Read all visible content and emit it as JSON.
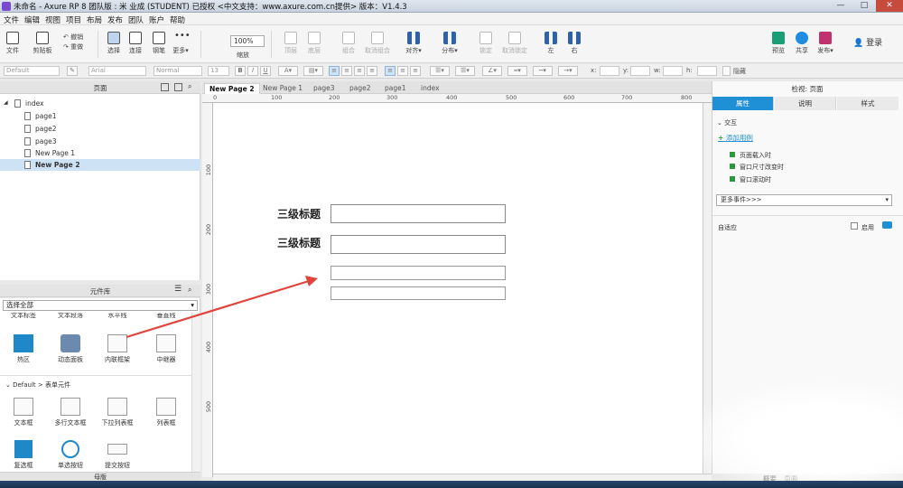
{
  "window": {
    "title": "未命名 - Axure RP 8 团队版 : 米 业成 (STUDENT) 已授权    <中文支持：www.axure.com.cn提供> 版本：V1.4.3",
    "min": "—",
    "max": "□",
    "close": "✕"
  },
  "menu": [
    "文件",
    "编辑",
    "视图",
    "项目",
    "布局",
    "发布",
    "团队",
    "账户",
    "帮助"
  ],
  "toolbar": {
    "file": "文件",
    "clipboard": "剪贴板",
    "undo": "撤销",
    "redo": "重做",
    "select": "选择",
    "connect": "连接",
    "pen": "钢笔",
    "more": "更多▾",
    "zoom_value": "100%",
    "zoom_label": "缩放",
    "top": "顶层",
    "bottom": "底层",
    "group": "组合",
    "ungroup": "取消组合",
    "align": "对齐▾",
    "distribute": "分布▾",
    "lock": "锁定",
    "unlock": "取消锁定",
    "left": "左",
    "right": "右",
    "preview": "预览",
    "share": "共享",
    "publish": "发布▾",
    "login": "登录",
    "user_icon": "user-icon"
  },
  "stylebar": {
    "style": "Default",
    "font": "Arial",
    "weight": "Normal",
    "size": "13",
    "x_label": "x:",
    "y_label": "y:",
    "w_label": "w:",
    "h_label": "h:",
    "hide": "隐藏"
  },
  "pages_panel": {
    "title": "页面",
    "items": [
      {
        "label": "index",
        "root": true
      },
      {
        "label": "page1"
      },
      {
        "label": "page2"
      },
      {
        "label": "page3"
      },
      {
        "label": "New Page 1"
      },
      {
        "label": "New Page 2",
        "selected": true
      }
    ]
  },
  "library": {
    "title": "元件库",
    "select": "选择全部",
    "row_cut": [
      "文本标签",
      "文本段落",
      "水平线",
      "垂直线"
    ],
    "row1": [
      "热区",
      "动态面板",
      "内联框架",
      "中继器"
    ],
    "section": "Default > 表单元件",
    "row2": [
      "文本框",
      "多行文本框",
      "下拉列表框",
      "列表框"
    ],
    "row3": [
      "复选框",
      "单选按钮",
      "提交按钮"
    ]
  },
  "bottom_panel": "母版",
  "tabs": [
    "New Page 2",
    "New Page 1",
    "page3",
    "page2",
    "page1",
    "index"
  ],
  "ruler_h": [
    "0",
    "100",
    "200",
    "300",
    "400",
    "500",
    "600",
    "700",
    "800"
  ],
  "ruler_v": [
    "100",
    "200",
    "300",
    "400",
    "500"
  ],
  "canvas": {
    "label1": "三级标题",
    "label2": "三级标题"
  },
  "inspector": {
    "title": "检视: 页面",
    "tabs": [
      "属性",
      "说明",
      "样式"
    ],
    "interaction": "交互",
    "add_case": "添加用例",
    "events": [
      "页面载入时",
      "窗口尺寸改变时",
      "窗口滚动时"
    ],
    "more_events": "更多事件>>>",
    "adaptive": "自适应",
    "enable": "启用"
  },
  "status": {
    "overview": "概要",
    "pages": "页面"
  },
  "colors": {
    "accent": "#1f8fd6",
    "arrow": "#e0443c",
    "selected_row": "#cde3f5"
  }
}
